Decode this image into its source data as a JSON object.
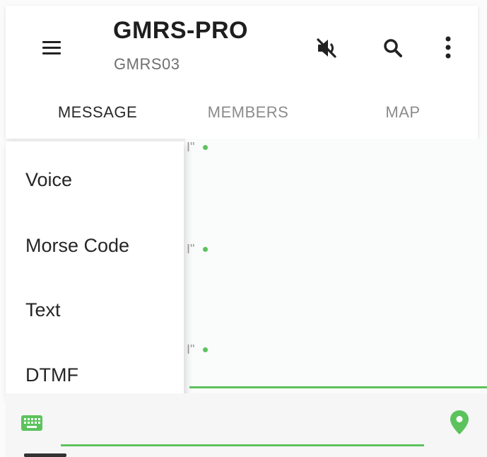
{
  "app_bar": {
    "title": "GMRS-PRO",
    "subtitle": "GMRS03",
    "icons": [
      "menu-icon",
      "volume-off-icon",
      "search-icon",
      "more-vert-icon"
    ]
  },
  "tabs": [
    {
      "label": "MESSAGE",
      "active": true
    },
    {
      "label": "MEMBERS",
      "active": false
    },
    {
      "label": "MAP",
      "active": false
    }
  ],
  "menu": {
    "items": [
      {
        "label": "Voice"
      },
      {
        "label": "Morse Code"
      },
      {
        "label": "Text"
      },
      {
        "label": "DTMF"
      }
    ]
  },
  "messages": [
    {
      "text": "I\""
    },
    {
      "text": "I\""
    },
    {
      "text": "I\""
    }
  ],
  "input": {
    "value": "",
    "placeholder": ""
  },
  "colors": {
    "accent": "#5cc35c",
    "text": "#222222",
    "inactive_tab": "#8c8c8c"
  }
}
